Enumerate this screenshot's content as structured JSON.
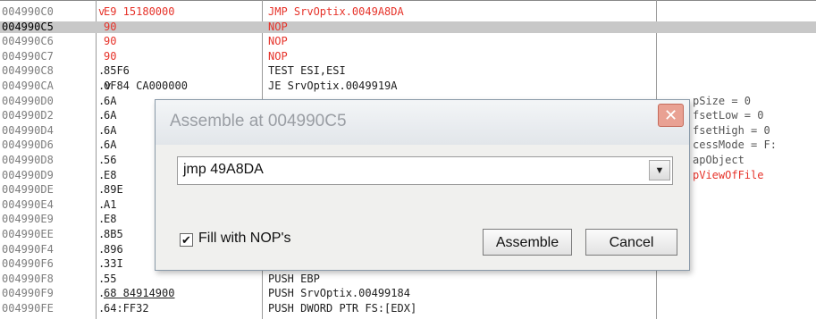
{
  "rows": [
    {
      "addr": "004990C0",
      "mark": "v",
      "hex": "E9 15180000",
      "instr": "JMP SrvOptix.0049A8DA",
      "cmt": "",
      "style": "red",
      "selected": false
    },
    {
      "addr": "004990C5",
      "mark": "",
      "hex": "90",
      "instr": "NOP",
      "cmt": "",
      "style": "red",
      "selected": true
    },
    {
      "addr": "004990C6",
      "mark": "",
      "hex": "90",
      "instr": "NOP",
      "cmt": "",
      "style": "red",
      "selected": false
    },
    {
      "addr": "004990C7",
      "mark": "",
      "hex": "90",
      "instr": "NOP",
      "cmt": "",
      "style": "red",
      "selected": false
    },
    {
      "addr": "004990C8",
      "mark": ".",
      "hex": "85F6",
      "instr": "TEST ESI,ESI",
      "cmt": "",
      "style": "blk",
      "selected": false
    },
    {
      "addr": "004990CA",
      "mark": ".v",
      "hex": "0F84 CA000000",
      "instr": "JE SrvOptix.0049919A",
      "cmt": "",
      "style": "blk",
      "selected": false
    },
    {
      "addr": "004990D0",
      "mark": ".",
      "hex": "6A",
      "instr": "",
      "cmt": "pSize = 0",
      "style": "blk",
      "selected": false
    },
    {
      "addr": "004990D2",
      "mark": ".",
      "hex": "6A",
      "instr": "",
      "cmt": "fsetLow = 0",
      "style": "blk",
      "selected": false
    },
    {
      "addr": "004990D4",
      "mark": ".",
      "hex": "6A",
      "instr": "",
      "cmt": "fsetHigh = 0",
      "style": "blk",
      "selected": false
    },
    {
      "addr": "004990D6",
      "mark": ".",
      "hex": "6A",
      "instr": "",
      "cmt": "cessMode = F:",
      "style": "blk",
      "selected": false
    },
    {
      "addr": "004990D8",
      "mark": ".",
      "hex": "56",
      "instr": "",
      "cmt": "apObject",
      "style": "blk",
      "selected": false
    },
    {
      "addr": "004990D9",
      "mark": ".",
      "hex": "E8",
      "instr": "",
      "cmt": "pViewOfFile",
      "style": "redcmt",
      "selected": false
    },
    {
      "addr": "004990DE",
      "mark": ".",
      "hex": "89E",
      "instr": "",
      "cmt": "",
      "style": "blk",
      "selected": false
    },
    {
      "addr": "004990E4",
      "mark": ".",
      "hex": "A1",
      "instr": "",
      "cmt": "",
      "style": "blk",
      "selected": false
    },
    {
      "addr": "004990E9",
      "mark": ".",
      "hex": "E8",
      "instr": "",
      "cmt": "",
      "style": "blk",
      "selected": false
    },
    {
      "addr": "004990EE",
      "mark": ".",
      "hex": "8B5",
      "instr": "",
      "cmt": "",
      "style": "blk",
      "selected": false
    },
    {
      "addr": "004990F4",
      "mark": ".",
      "hex": "896",
      "instr": "",
      "cmt": "",
      "style": "blk",
      "selected": false
    },
    {
      "addr": "004990F6",
      "mark": ".",
      "hex": "33I",
      "instr": "",
      "cmt": "",
      "style": "blk",
      "selected": false
    },
    {
      "addr": "004990F8",
      "mark": ".",
      "hex": "55",
      "instr": "PUSH EBP",
      "cmt": "",
      "style": "blk",
      "selected": false
    },
    {
      "addr": "004990F9",
      "mark": ".",
      "hex": "68 84914900",
      "instr": "PUSH SrvOptix.00499184",
      "cmt": "",
      "style": "blk",
      "selected": false
    },
    {
      "addr": "004990FE",
      "mark": ".",
      "hex": "64:FF32",
      "instr": "PUSH DWORD PTR FS:[EDX]",
      "cmt": "",
      "style": "blk",
      "selected": false
    }
  ],
  "colors": {
    "accent_red": "#e6332a",
    "selection": "#c8c8c8",
    "close_button": "#e9a193"
  },
  "dialog": {
    "title": "Assemble at 004990C5",
    "close_glyph": "✕",
    "input_value": "jmp 49A8DA",
    "dropdown_glyph": "▼",
    "checkbox_checked": true,
    "checkbox_glyph": "✔",
    "checkbox_label": "Fill with NOP's",
    "assemble_label": "Assemble",
    "cancel_label": "Cancel"
  }
}
